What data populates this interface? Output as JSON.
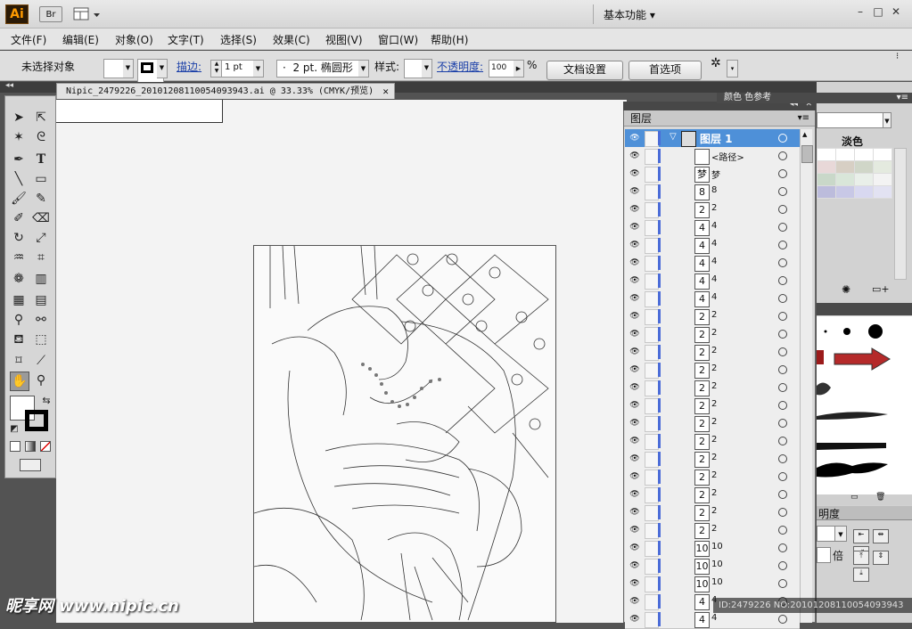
{
  "app": {
    "logo": "Ai",
    "bridge": "Br",
    "workspace": "基本功能",
    "window_buttons": [
      "–",
      "□",
      "✕"
    ]
  },
  "menu": [
    "文件(F)",
    "编辑(E)",
    "对象(O)",
    "文字(T)",
    "选择(S)",
    "效果(C)",
    "视图(V)",
    "窗口(W)",
    "帮助(H)"
  ],
  "control": {
    "selection": "未选择对象",
    "stroke_label": "描边:",
    "stroke_weight": "1 pt",
    "brush": "2 pt. 椭圆形",
    "style_label": "样式:",
    "opacity_label": "不透明度:",
    "opacity_value": "100",
    "opacity_unit": "%",
    "doc_setup": "文档设置",
    "preferences": "首选项"
  },
  "document": {
    "tab_title": "Nipic_2479226_20101208110054093943.ai @ 33.33% (CMYK/预览)",
    "tab_close": "✕"
  },
  "layers_panel": {
    "title": "图层",
    "selected_layer": "图层 1",
    "rows": [
      {
        "thumb": "",
        "name": "<路径>"
      },
      {
        "thumb": "梦",
        "name": "梦"
      },
      {
        "thumb": "8",
        "name": "8"
      },
      {
        "thumb": "2",
        "name": "2"
      },
      {
        "thumb": "4",
        "name": "4"
      },
      {
        "thumb": "4",
        "name": "4"
      },
      {
        "thumb": "4",
        "name": "4"
      },
      {
        "thumb": "4",
        "name": "4"
      },
      {
        "thumb": "4",
        "name": "4"
      },
      {
        "thumb": "2",
        "name": "2"
      },
      {
        "thumb": "2",
        "name": "2"
      },
      {
        "thumb": "2",
        "name": "2"
      },
      {
        "thumb": "2",
        "name": "2"
      },
      {
        "thumb": "2",
        "name": "2"
      },
      {
        "thumb": "2",
        "name": "2"
      },
      {
        "thumb": "2",
        "name": "2"
      },
      {
        "thumb": "2",
        "name": "2"
      },
      {
        "thumb": "2",
        "name": "2"
      },
      {
        "thumb": "2",
        "name": "2"
      },
      {
        "thumb": "2",
        "name": "2"
      },
      {
        "thumb": "2",
        "name": "2"
      },
      {
        "thumb": "2",
        "name": "2"
      },
      {
        "thumb": "10",
        "name": "10"
      },
      {
        "thumb": "10",
        "name": "10"
      },
      {
        "thumb": "10",
        "name": "10"
      },
      {
        "thumb": "4",
        "name": "4"
      },
      {
        "thumb": "4",
        "name": "4"
      }
    ]
  },
  "right_panel": {
    "tabs": "颜色 色参考",
    "swatch_group": "淡色",
    "transparency_tab": "明度",
    "multiplier": "倍",
    "swatch_colors": [
      "#ffffff",
      "#ffffff",
      "#ffffff",
      "#ffffff",
      "#e8d8d8",
      "#d7cfc4",
      "#d0d6c8",
      "#e4eadf",
      "#c9d8c9",
      "#d9e6d9",
      "#e9efe9",
      "#f3f3f3",
      "#bcbcdc",
      "#c8c8e6",
      "#d8d8f0",
      "#e2e2f2"
    ]
  },
  "watermark": {
    "left": "昵享网 www.nipic.cn",
    "right": "ID:2479226 NO:20101208110054093943"
  }
}
